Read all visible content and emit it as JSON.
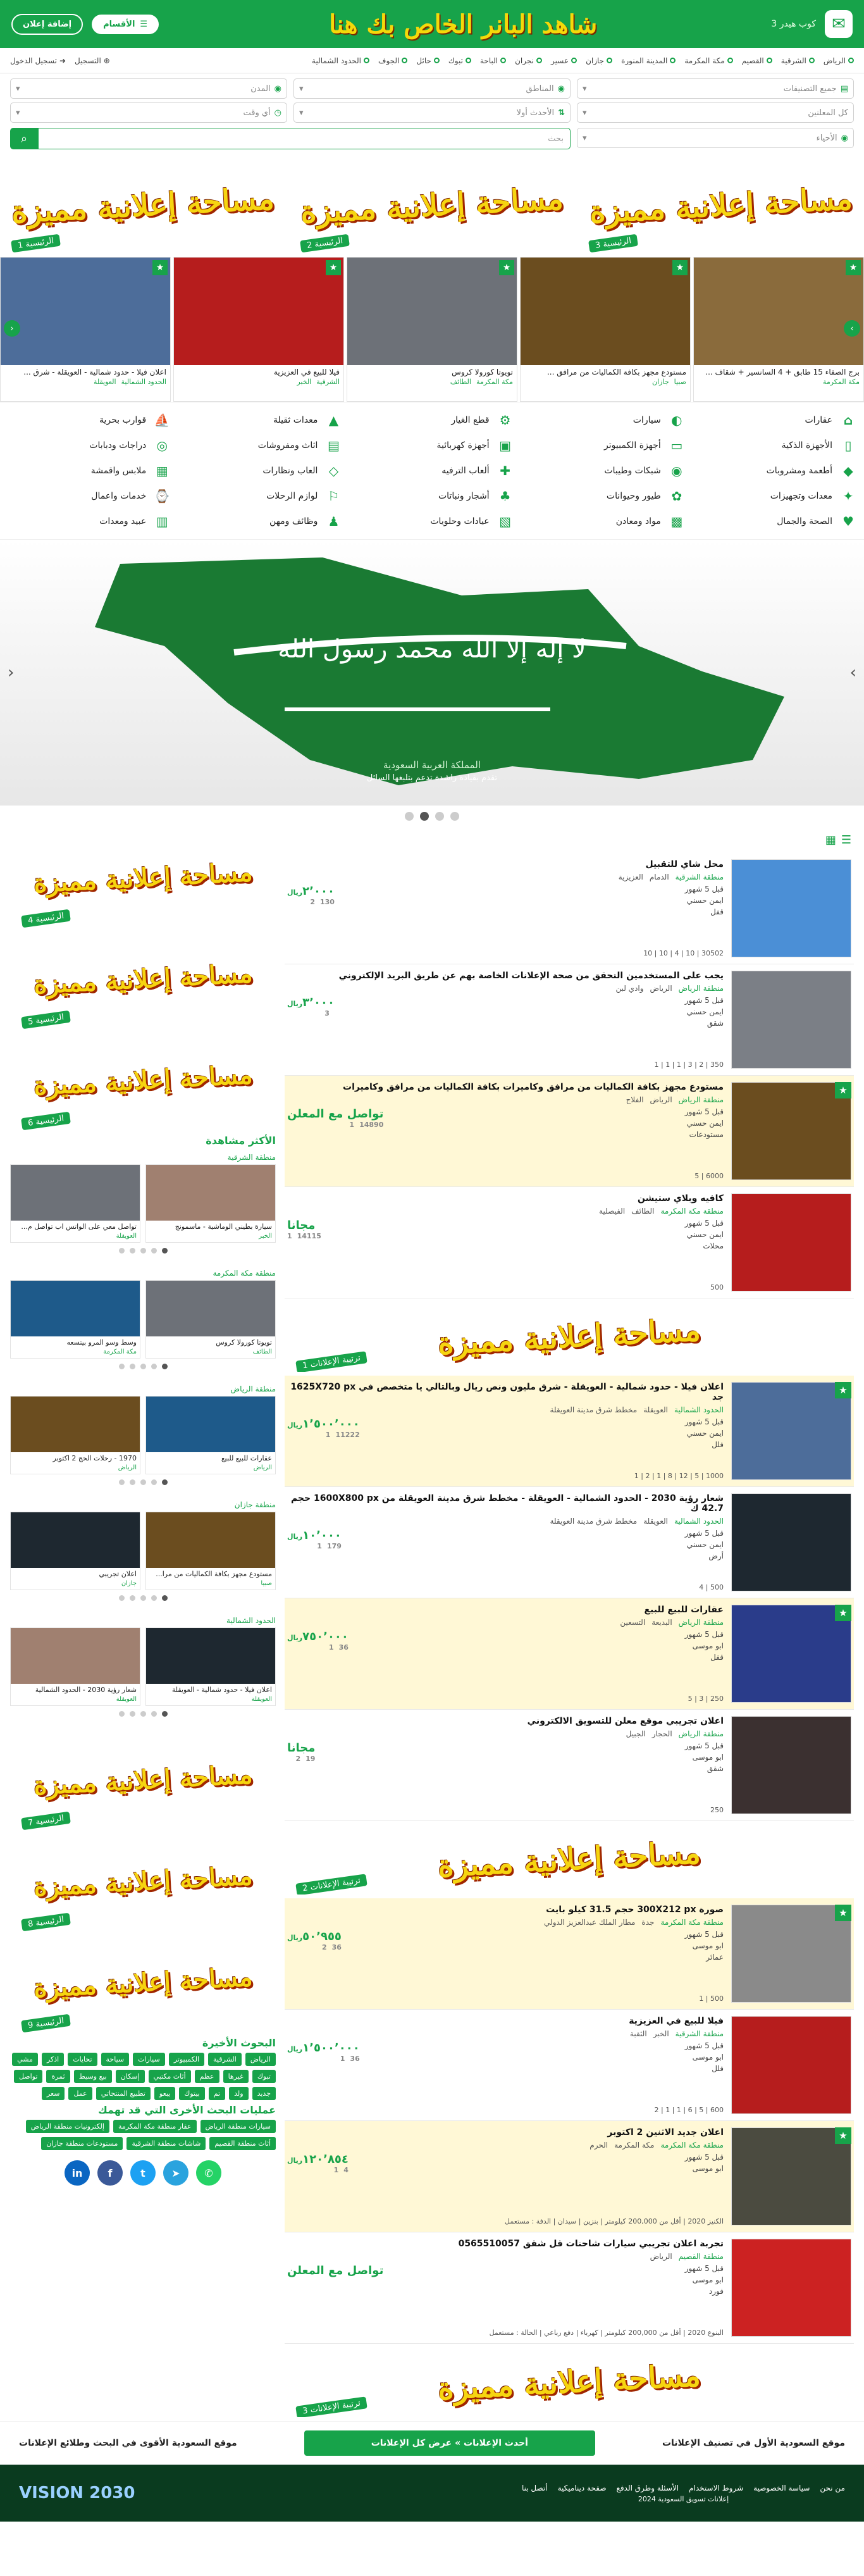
{
  "header": {
    "brand": "كوب هيدر 3",
    "slogan": "شاهد البانر الخاص بك هنا",
    "sections_label": "الأقسام",
    "add_ad_label": "إضافة إعلان"
  },
  "topnav": {
    "items": [
      "الرياض",
      "الشرقية",
      "القصيم",
      "مكة المكرمة",
      "المدينة المنورة",
      "جازان",
      "عسير",
      "نجران",
      "الباحة",
      "تبوك",
      "حائل",
      "الجوف",
      "الحدود الشمالية"
    ],
    "register": "التسجيل",
    "login": "تسجيل الدخول"
  },
  "search": {
    "categories": "جميع التصنيفات",
    "regions": "المناطق",
    "cities": "المدن",
    "districts": "الأحياء",
    "sort": "الأحدث أولا",
    "time": "أي وقت",
    "advertisers": "كل المعلنين",
    "placeholder": "بحث"
  },
  "promos": {
    "text": "مساحة إعلانية مميزة",
    "labels": [
      "الرئيسية 1",
      "الرئيسية 2",
      "الرئيسية 3"
    ]
  },
  "carousel": [
    {
      "title": "برج الصفاء 15 طابق + 4 السانسير + شقاف ...",
      "city": "مكة المكرمة",
      "district": "",
      "color": "#8a6b3c"
    },
    {
      "title": "مستودع مجهز بكافة الكماليات من مرافق ...",
      "city": "صبيا",
      "district": "جازان",
      "color": "#6b4d1f"
    },
    {
      "title": "تويوتا كورولا كروس",
      "city": "مكة المكرمة",
      "district": "الطائف",
      "color": "#6d7178"
    },
    {
      "title": "فيلا للبيع في العزيزية",
      "city": "الشرقية",
      "district": "الخبر",
      "color": "#b61d1d"
    },
    {
      "title": "اعلان فيلا - حدود شمالية - العويقلة - شرق ...",
      "city": "الحدود الشمالية",
      "district": "العويقلة",
      "color": "#4d6d9a"
    }
  ],
  "categories": [
    {
      "label": "عقارات",
      "icon": "⌂"
    },
    {
      "label": "سيارات",
      "icon": "◐"
    },
    {
      "label": "قطع الغيار",
      "icon": "⚙"
    },
    {
      "label": "معدات ثقيلة",
      "icon": "▲"
    },
    {
      "label": "قوارب بحرية",
      "icon": "⛵"
    },
    {
      "label": "الأجهزة الذكية",
      "icon": "▯"
    },
    {
      "label": "أجهزة الكمبيوتر",
      "icon": "▭"
    },
    {
      "label": "أجهزة كهربائية",
      "icon": "▣"
    },
    {
      "label": "اثاث ومفروشات",
      "icon": "▤"
    },
    {
      "label": "دراجات ودبابات",
      "icon": "◎"
    },
    {
      "label": "أطعمة ومشروبات",
      "icon": "◆"
    },
    {
      "label": "شبكات وطيبات",
      "icon": "◉"
    },
    {
      "label": "ألعاب الترفيه",
      "icon": "✚"
    },
    {
      "label": "العاب ونظارات",
      "icon": "◇"
    },
    {
      "label": "ملابس واقمشة",
      "icon": "▦"
    },
    {
      "label": "معدات وتجهيزات",
      "icon": "✦"
    },
    {
      "label": "طيور وحيوانات",
      "icon": "✿"
    },
    {
      "label": "أشجار ونباتات",
      "icon": "♣"
    },
    {
      "label": "لوازم الرحلات",
      "icon": "⚐"
    },
    {
      "label": "خدمات واعمال",
      "icon": "⌚"
    },
    {
      "label": "الصحة والجمال",
      "icon": "♥"
    },
    {
      "label": "مواد ومعادن",
      "icon": "▩"
    },
    {
      "label": "عيادات وحلويات",
      "icon": "▧"
    },
    {
      "label": "وظائف ومهن",
      "icon": "♟"
    },
    {
      "label": "عبيد ومعدات",
      "icon": "▥"
    }
  ],
  "hero": {
    "caption1": "المملكة العربية السعودية",
    "caption2": "تقدم بقيادة راشدة تدعم بتلبغها السائل",
    "flag_text": "لا إله إلا الله محمد رسول الله"
  },
  "ads": [
    {
      "title": "محل شاي للتقبيل",
      "region": "منطقة الشرقية",
      "city": "الدمام",
      "district": "العزيزية",
      "time": "قبل 5 شهور",
      "author": "ايمن حسني",
      "price": "٢٬٠٠٠",
      "unit": "ريال",
      "type": "قفل",
      "views": "130",
      "comments": "2",
      "spec": "30502 | 10 | 4 | 10 | 10",
      "thumb": "#4b8fd6",
      "hl": false,
      "star": false
    },
    {
      "title": "يجب على المستخدمين التحقق من صحة الإعلانات الخاصة بهم عن طريق البريد الإلكتروني",
      "region": "منطقة الرياض",
      "city": "الرياض",
      "district": "وادي لبن",
      "time": "قبل 5 شهور",
      "author": "ايمن حسني",
      "price": "٣٬٠٠٠",
      "unit": "ريال",
      "type": "شقق",
      "views": "",
      "comments": "3",
      "spec": "350 | 2 | 3 | 1 | 1 | 1",
      "thumb": "#7b7f86",
      "hl": false,
      "star": false
    },
    {
      "title": "مستودع مجهز بكافة الكماليات من مرافق وكاميرات بكافة الكماليات من مرافق وكاميرات",
      "region": "منطقة الرياض",
      "city": "الرياض",
      "district": "الفلاج",
      "time": "قبل 5 شهور",
      "author": "ايمن حسني",
      "price": "تواصل مع المعلن",
      "unit": "",
      "type": "مستودعات",
      "views": "14890",
      "comments": "1",
      "spec": "6000 | 5",
      "thumb": "#6b4d1f",
      "hl": true,
      "star": true
    },
    {
      "title": "كافيه وبلاي ستيشن",
      "region": "منطقة مكة المكرمة",
      "city": "الطائف",
      "district": "الفيصلية",
      "time": "قبل 5 شهور",
      "author": "ايمن حسني",
      "price": "مجانا",
      "unit": "",
      "type": "محلات",
      "views": "14115",
      "comments": "1",
      "spec": "500",
      "thumb": "#b61d1d",
      "hl": false,
      "star": false
    },
    {
      "title": "اعلان فيلا - حدود شمالية - العويقلة - شرق مليون ونص ريال وبالتالي يا متخصص في 1625X720 px جد",
      "region": "الحدود الشمالية",
      "city": "العويقلة",
      "district": "مخطط شرق مدينة العويقلة",
      "time": "قبل 5 شهور",
      "author": "ايمن حسني",
      "price": "١٬٥٠٠٬٠٠٠",
      "unit": "ريال",
      "type": "فلل",
      "views": "11222",
      "comments": "1",
      "spec": "1000 | 5 | 12 | 8 | 1 | 2 | 1",
      "thumb": "#4d6d9a",
      "hl": true,
      "star": true
    },
    {
      "title": "شعار رؤية 2030 - الحدود الشمالية - العويقلة - مخطط شرق مدينة العويقلة من 1600X800 px حجم 42.7 ك",
      "region": "الحدود الشمالية",
      "city": "العويقلة",
      "district": "مخطط شرق مدينة العويقلة",
      "time": "قبل 5 شهور",
      "author": "ايمن حسني",
      "price": "١٠٬٠٠٠",
      "unit": "ريال",
      "type": "أرض",
      "views": "179",
      "comments": "1",
      "spec": "500 | 4",
      "thumb": "#1e2830",
      "hl": false,
      "star": false
    },
    {
      "title": "عقارات للبيع للبيع",
      "region": "منطقة الرياض",
      "city": "البديعة",
      "district": "التسعين",
      "time": "قبل 5 شهور",
      "author": "ابو موسى",
      "price": "٧٥٠٬٠٠٠",
      "unit": "ريال",
      "type": "قفل",
      "views": "36",
      "comments": "1",
      "spec": "250 | 3 | 5",
      "thumb": "#2a3c8a",
      "hl": true,
      "star": true
    },
    {
      "title": "اعلان تجريبي موقع معلن للتسويق الالكتروني",
      "region": "منطقة الرياض",
      "city": "الحجار",
      "district": "الجبيل",
      "time": "قبل 5 شهور",
      "author": "ابو موسى",
      "price": "مجانا",
      "unit": "",
      "type": "شقق",
      "views": "19",
      "comments": "2",
      "spec": "250",
      "thumb": "#3b3030",
      "hl": false,
      "star": false
    },
    {
      "title": "صورة 300X212 px حجم 31.5 كيلو بايت",
      "region": "منطقة مكة المكرمة",
      "city": "جدة",
      "district": "مطار الملك عبدالعزيز الدولي",
      "time": "قبل 5 شهور",
      "author": "ابو موسى",
      "price": "٥٠٬٩٥٥",
      "unit": "ريال",
      "type": "عمائر",
      "views": "36",
      "comments": "2",
      "spec": "500 | 1",
      "thumb": "#8a8a8a",
      "hl": true,
      "star": true
    },
    {
      "title": "فيلا للبيع في العزيزية",
      "region": "منطقة الشرقية",
      "city": "الخبر",
      "district": "الثقبة",
      "time": "قبل 5 شهور",
      "author": "ابو موسى",
      "price": "١٬٥٠٠٬٠٠٠",
      "unit": "ريال",
      "type": "فلل",
      "views": "36",
      "comments": "1",
      "spec": "600 | 5 | 6 | 1 | 1 | 2",
      "thumb": "#b61d1d",
      "hl": false,
      "star": false
    },
    {
      "title": "اعلان جديد الاثنين 2 اكتوبر",
      "region": "منطقة مكة المكرمة",
      "city": "مكة المكرمة",
      "district": "الحرم",
      "time": "قبل 5 شهور",
      "author": "ابو موسى",
      "price": "١٢٠٬٨٥٤",
      "unit": "ريال",
      "type": "",
      "views": "4",
      "comments": "1",
      "spec": "الكنيز 2020 | أقل من 200,000 كيلومتر | بنزين | سيدان | الدفة : مستعمل",
      "thumb": "#4b4b40",
      "hl": true,
      "star": true
    },
    {
      "title": "تجربة اعلان تجريبي سيارات شاحنات قل شقق 0565510057",
      "region": "منطقة القصيم",
      "city": "الرياض",
      "district": "",
      "time": "قبل 5 شهور",
      "author": "ابو موسى",
      "price": "تواصل مع المعلن",
      "unit": "",
      "type": "فورد",
      "views": "",
      "comments": "",
      "spec": "البنوع 2020 | أقل من 200,000 كيلومتر | كهرباء | دفع رباعي | الحالة : مستعمل",
      "thumb": "#c22",
      "hl": false,
      "star": false
    }
  ],
  "midpromos": [
    "ترتيبة الإعلانات 1",
    "ترتيبة الإعلانات 2",
    "ترتيبة الإعلانات 3"
  ],
  "side": {
    "promo_labels": [
      "الرئيسية 4",
      "الرئيسية 5",
      "الرئيسية 6",
      "الرئيسية 7",
      "الرئيسية 8",
      "الرئيسية 9"
    ],
    "most_viewed": "الأكثر مشاهدة",
    "regions": [
      {
        "name": "منطقة الشرقية",
        "cards": [
          {
            "t": "سيارة بطيني الوماشية - ماسمونج",
            "m": "الخبر"
          },
          {
            "t": "تواصل معي على الواتس اب تواصل م...",
            "m": "العويقلة"
          }
        ]
      },
      {
        "name": "منطقة مكة المكرمة",
        "cards": [
          {
            "t": "تويوتا كورولا كروس",
            "m": "الطائف"
          },
          {
            "t": "وسط وسو المرو بيتسعه",
            "m": "مكة المكرمة"
          }
        ]
      },
      {
        "name": "منطقة الرياض",
        "cards": [
          {
            "t": "عقارات للبيع للبيع",
            "m": "الرياض"
          },
          {
            "t": "1970 - رحلات الحج 2 اكتوبر",
            "m": "الرياض"
          }
        ]
      },
      {
        "name": "منطقة جازان",
        "cards": [
          {
            "t": "مستودع مجهز بكافة الكماليات من مرا...",
            "m": "صبيا"
          },
          {
            "t": "اعلان تجريبي",
            "m": "جازان"
          }
        ]
      },
      {
        "name": "الحدود الشمالية",
        "cards": [
          {
            "t": "اعلان فيلا - حدود شمالية - العويقلة",
            "m": "العويقلة"
          },
          {
            "t": "شعار رؤية 2030 - الحدود الشمالية",
            "m": "العويقلة"
          }
        ]
      }
    ],
    "recent_title": "البحوث الأخيرة",
    "recent": [
      "الرياض",
      "الشرقية",
      "الكمبيوتر",
      "سيارات",
      "سياحة",
      "تحايات",
      "اذكر",
      "مشي",
      "تبوك",
      "غيرها",
      "عظم",
      "أثاث مكتبي",
      "إسكان",
      "بيع وسيط",
      "ثمرة",
      "تواصل",
      "جديد",
      "ولد",
      "تم",
      "بيتوك",
      "يبعو",
      "تطبيع المنتجاتي",
      "عمل",
      "سعر"
    ],
    "other_title": "عمليات البحث الأخرى التي قد تهمك",
    "other": [
      "سيارات منطقة الرياض",
      "عقار منطقة مكة المكرمة",
      "إلكترونيات منطقة الرياض",
      "أثاث منطقة القصيم",
      "شاشات منطقة الشرقية",
      "مستودعات منطقة جازان"
    ]
  },
  "footer": {
    "left": "موقع السعودية الأقوى في البحث وطلائع الإعلانات",
    "button": "أحدث الإعلانات » عرض كل الإعلانات",
    "right": "موقع السعودية الأول في تصنيف الإعلانات",
    "links": [
      "من نحن",
      "سياسة الخصوصية",
      "شروط الاستخدام",
      "الأسئلة وطرق الدفع",
      "صفحة ديناميكية",
      "أتصل بنا"
    ],
    "copy": "إعلانات تسويق السعودية 2024",
    "vision": "VISION 2030"
  }
}
